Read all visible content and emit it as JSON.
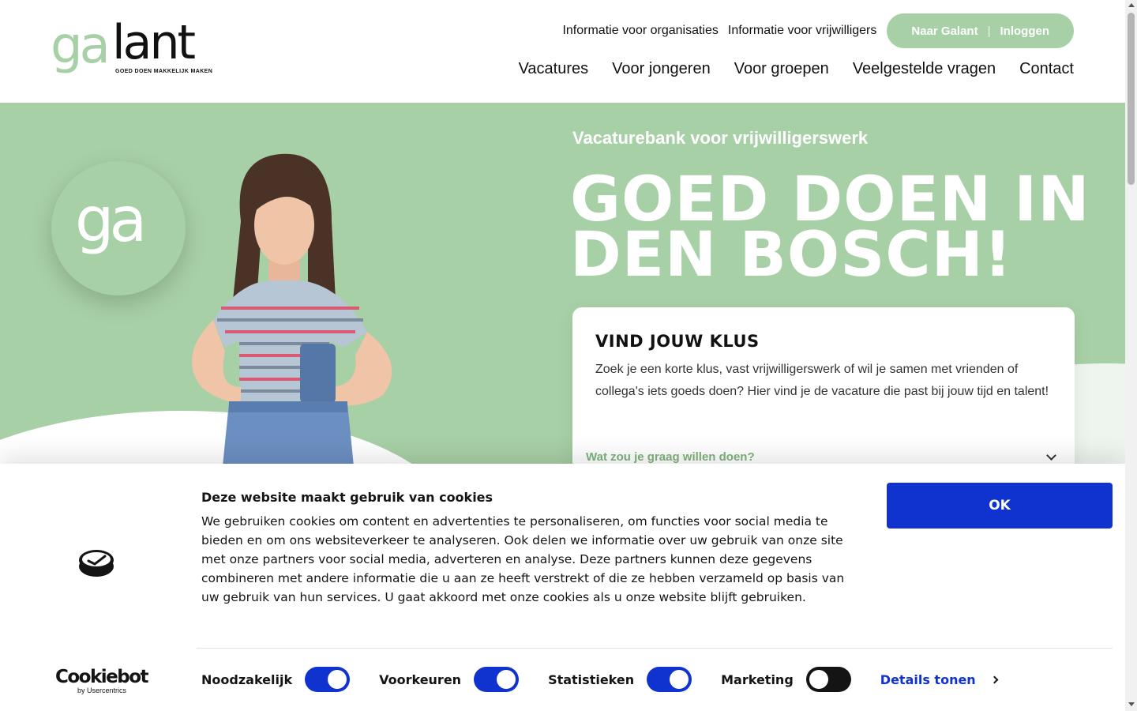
{
  "logo": {
    "ga": "ga",
    "lant": "lant",
    "tagline": "GOED DOEN MAKKELIJK MAKEN"
  },
  "top_links": [
    "Informatie voor organisaties",
    "Informatie voor vrijwilligers"
  ],
  "pill": {
    "left": "Naar Galant",
    "separator": "|",
    "right": "Inloggen"
  },
  "main_nav": [
    "Vacatures",
    "Voor jongeren",
    "Voor groepen",
    "Veelgestelde vragen",
    "Contact"
  ],
  "hero": {
    "circle_text": "ga",
    "subtitle": "Vacaturebank voor vrijwilligerswerk",
    "headline_line1": "GOED DOEN IN",
    "headline_line2": "DEN BOSCH!"
  },
  "search_card": {
    "title": "VIND JOUW KLUS",
    "text": "Zoek je een korte klus, vast vrijwilligerswerk of wil je samen met vrienden of collega's iets goeds doen? Hier vind je de vacature die past bij jouw tijd en talent!",
    "dropdown_placeholder": "Wat zou je graag willen doen?"
  },
  "cookie_banner": {
    "title": "Deze website maakt gebruik van cookies",
    "text": "We gebruiken cookies om content en advertenties te personaliseren, om functies voor social media te bieden en om ons websiteverkeer te analyseren. Ook delen we informatie over uw gebruik van onze site met onze partners voor social media, adverteren en analyse. Deze partners kunnen deze gegevens combineren met andere informatie die u aan ze heeft verstrekt of die ze hebben verzameld op basis van uw gebruik van hun services. U gaat akkoord met onze cookies als u onze website blijft gebruiken.",
    "ok_label": "OK",
    "brand_name": "Cookiebot",
    "brand_by": "by Usercentrics",
    "toggles": [
      {
        "label": "Noodzakelijk",
        "on": true
      },
      {
        "label": "Voorkeuren",
        "on": true
      },
      {
        "label": "Statistieken",
        "on": true
      },
      {
        "label": "Marketing",
        "on": false
      }
    ],
    "details_label": "Details tonen"
  },
  "colors": {
    "brand_green": "#a8d0a6",
    "cookie_blue": "#1032cf",
    "text_dark": "#141414"
  }
}
